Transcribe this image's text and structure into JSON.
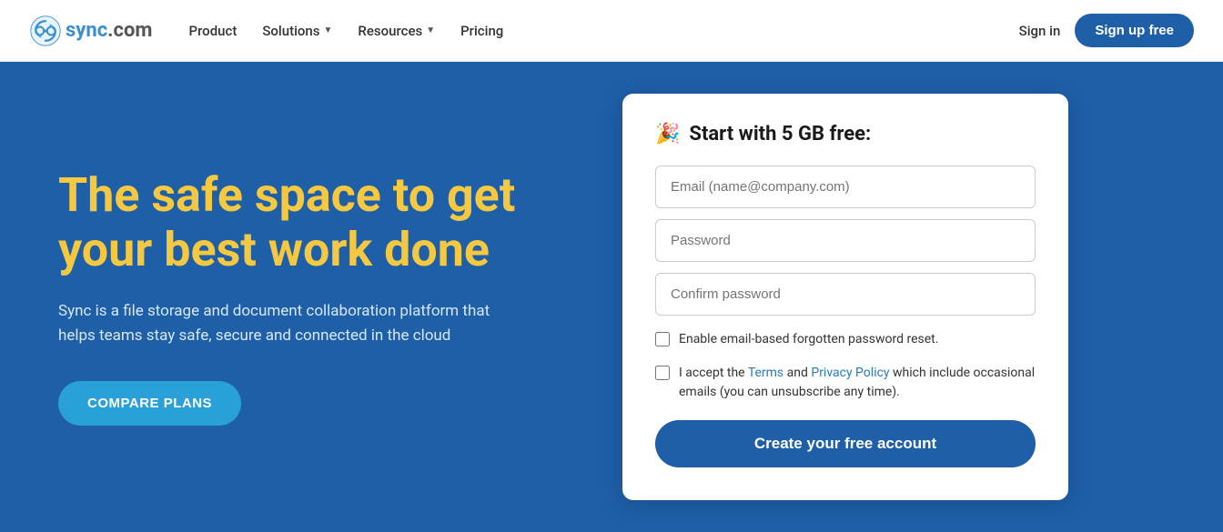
{
  "navbar": {
    "logo_text_main": "sync",
    "logo_text_domain": ".com",
    "nav_links": [
      {
        "label": "Product",
        "has_dropdown": false
      },
      {
        "label": "Solutions",
        "has_dropdown": true
      },
      {
        "label": "Resources",
        "has_dropdown": true
      },
      {
        "label": "Pricing",
        "has_dropdown": false
      }
    ],
    "sign_in_label": "Sign in",
    "sign_up_label": "Sign up free"
  },
  "hero": {
    "title": "The safe space to get your best work done",
    "subtitle": "Sync is a file storage and document collaboration platform that helps teams stay safe, secure and connected in the cloud",
    "compare_btn_label": "COMPARE PLANS"
  },
  "signup_card": {
    "title": "Start with 5 GB free:",
    "title_emoji": "🎉",
    "email_placeholder": "Email (name@company.com)",
    "password_placeholder": "Password",
    "confirm_password_placeholder": "Confirm password",
    "checkbox1_label": "Enable email-based forgotten password reset.",
    "checkbox2_label_pre": "I accept the ",
    "checkbox2_terms": "Terms",
    "checkbox2_and": " and ",
    "checkbox2_privacy": "Privacy Policy",
    "checkbox2_label_post": " which include occasional emails (you can unsubscribe any time).",
    "create_btn_label": "Create your free account"
  }
}
